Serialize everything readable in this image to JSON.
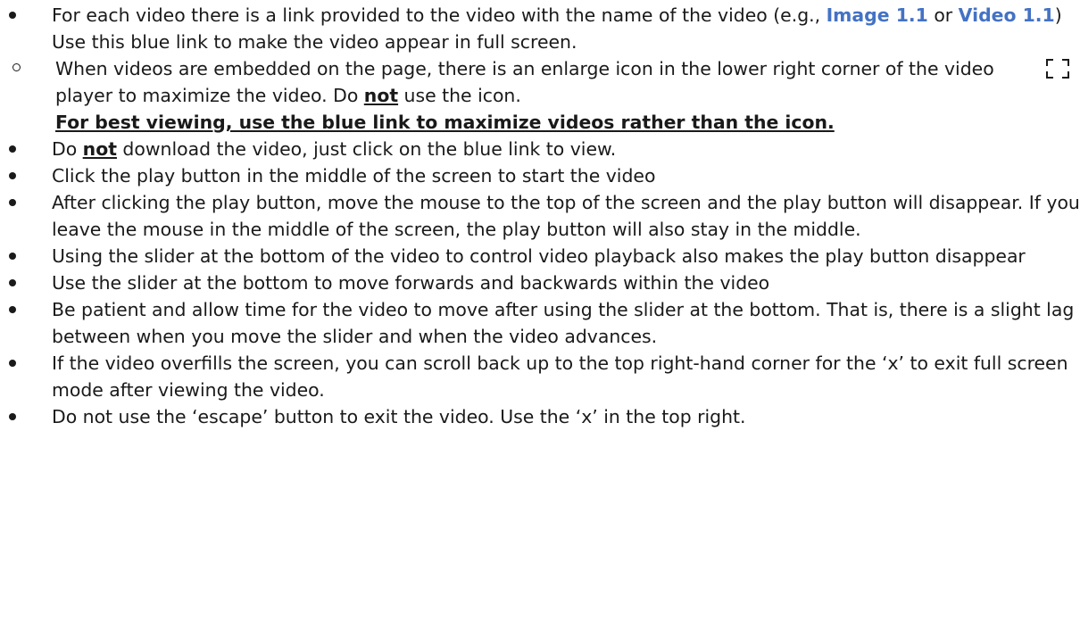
{
  "bullets": {
    "b1": {
      "pre": "For each video there is a link provided to the video with the name of the video (e.g., ",
      "link1": "Image 1.1",
      "mid": " or ",
      "link2": "Video 1.1",
      "post": ") Use this blue link to make the video appear in full screen.",
      "sub": {
        "pre": "When videos are embedded on the page, there is an enlarge icon in the lower right corner of the video player to maximize the video. Do ",
        "emph": "not",
        "post": " use the icon.",
        "note": "For best viewing, use the blue link to maximize videos rather than the icon.",
        "icon": "enlarge-icon"
      }
    },
    "b2": {
      "pre": "Do ",
      "emph": "not",
      "post": " download the video, just click on the blue link to view."
    },
    "b3": "Click the play button in the middle of the screen to start the video",
    "b4": "After clicking the play button, move the mouse to the top of the screen and the play button will disappear. If you leave the mouse in the middle of the screen, the play button will also stay in the middle.",
    "b5": "Using the slider at the bottom of the video to control video playback also makes the play button disappear",
    "b6": "Use the slider at the bottom to move forwards and backwards within the video",
    "b7": "Be patient and allow time for the video to move after using the slider at the bottom. That is, there is a slight lag between when you move the slider and when the video advances.",
    "b8": "If the video overfills the screen, you can scroll back up to the top right-hand corner for the ‘x’ to exit full screen mode after viewing the video.",
    "b9": "Do not use the ‘escape’ button to exit the video. Use the ‘x’ in the top right."
  },
  "colors": {
    "link": "#4472c4",
    "text": "#1a1a1a"
  }
}
